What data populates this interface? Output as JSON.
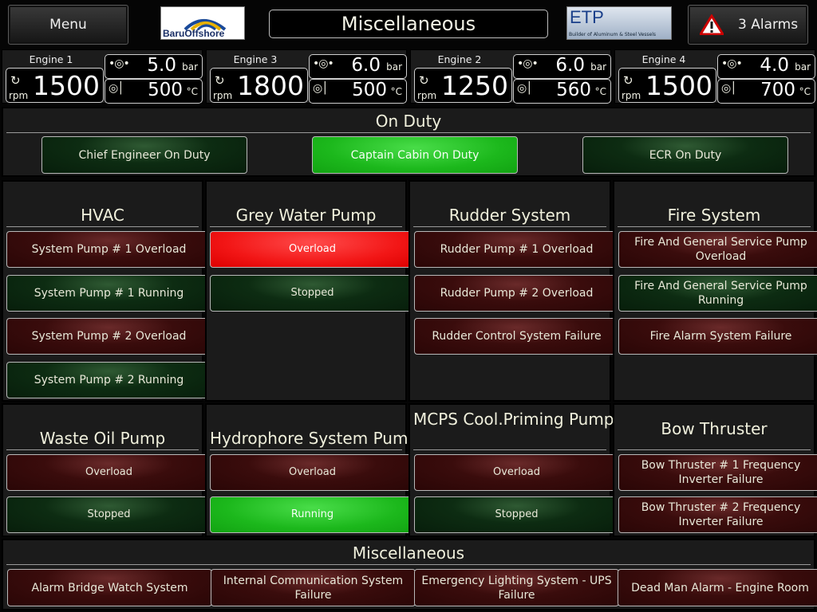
{
  "header": {
    "menu_label": "Menu",
    "title": "Miscellaneous",
    "alarms_label": "3 Alarms",
    "logo_left_text": "BaruOffshore",
    "logo_right_text": "ETP",
    "logo_right_subtext": "Builder of Aluminum & Steel Vessels"
  },
  "engines": [
    {
      "name": "Engine 1",
      "rpm": "1500",
      "rpm_unit": "rpm",
      "pressure": "5.0",
      "pressure_unit": "bar",
      "temp": "500",
      "temp_unit": "°C"
    },
    {
      "name": "Engine 3",
      "rpm": "1800",
      "rpm_unit": "rpm",
      "pressure": "6.0",
      "pressure_unit": "bar",
      "temp": "500",
      "temp_unit": "°C"
    },
    {
      "name": "Engine 2",
      "rpm": "1250",
      "rpm_unit": "rpm",
      "pressure": "6.0",
      "pressure_unit": "bar",
      "temp": "560",
      "temp_unit": "°C"
    },
    {
      "name": "Engine 4",
      "rpm": "1500",
      "rpm_unit": "rpm",
      "pressure": "4.0",
      "pressure_unit": "bar",
      "temp": "700",
      "temp_unit": "°C"
    }
  ],
  "on_duty": {
    "title": "On Duty",
    "buttons": [
      "Chief Engineer On Duty",
      "Captain Cabin On Duty",
      "ECR On Duty"
    ]
  },
  "hvac": {
    "title": "HVAC",
    "items": [
      "System Pump # 1 Overload",
      "System Pump # 1 Running",
      "System Pump # 2 Overload",
      "System Pump # 2 Running"
    ]
  },
  "grey_water": {
    "title": "Grey Water Pump",
    "items": [
      "Overload",
      "Stopped"
    ]
  },
  "rudder": {
    "title": "Rudder System",
    "items": [
      "Rudder Pump # 1 Overload",
      "Rudder Pump # 2 Overload",
      "Rudder Control System Failure"
    ]
  },
  "fire": {
    "title": "Fire System",
    "items": [
      "Fire And General Service Pump Overload",
      "Fire And General Service Pump Running",
      "Fire Alarm System Failure"
    ]
  },
  "waste_oil": {
    "title": "Waste Oil Pump",
    "items": [
      "Overload",
      "Stopped"
    ]
  },
  "hydrophore": {
    "title": "Hydrophore System Pump",
    "items": [
      "Overload",
      "Running"
    ]
  },
  "mcps": {
    "title": "MCPS Cool.Priming Pump",
    "items": [
      "Overload",
      "Stopped"
    ]
  },
  "bow": {
    "title": "Bow Thruster",
    "items": [
      "Bow Thruster # 1 Frequency Inverter Failure",
      "Bow Thruster # 2 Frequency Inverter Failure"
    ]
  },
  "misc": {
    "title": "Miscellaneous",
    "items": [
      "Alarm Bridge Watch System",
      "Internal Communication System Failure",
      "Emergency Lighting System - UPS Failure",
      "Dead Man Alarm - Engine Room"
    ]
  }
}
